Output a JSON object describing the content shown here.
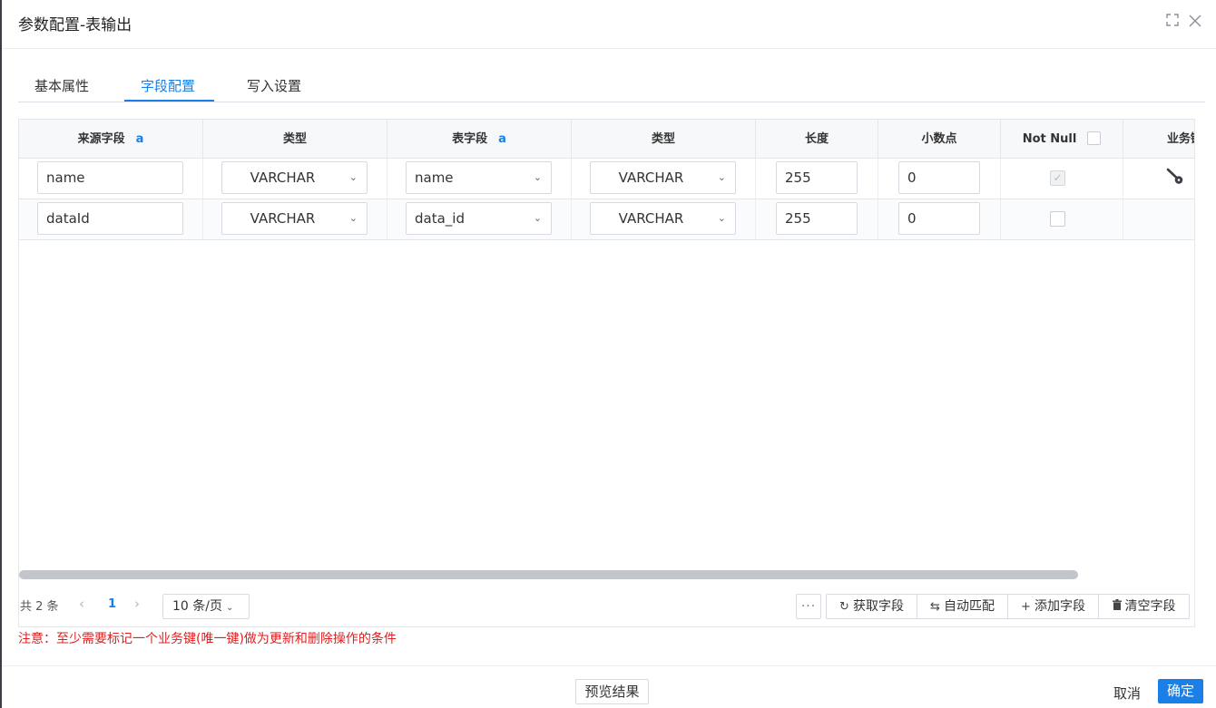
{
  "dialog": {
    "title": "参数配置-表输出",
    "maximize_icon": "expand-icon",
    "close_icon": "close-icon"
  },
  "tabs": [
    {
      "label": "基本属性",
      "active": false
    },
    {
      "label": "字段配置",
      "active": true
    },
    {
      "label": "写入设置",
      "active": false
    }
  ],
  "accent_color": "#1a7fe6",
  "table": {
    "columns": [
      {
        "label": "来源字段",
        "suffix": "a"
      },
      {
        "label": "类型"
      },
      {
        "label": "表字段",
        "suffix": "a"
      },
      {
        "label": "类型"
      },
      {
        "label": "长度"
      },
      {
        "label": "小数点"
      },
      {
        "label": "Not Null"
      },
      {
        "label": "业务键"
      }
    ],
    "rows": [
      {
        "source_field": "name",
        "source_type": "VARCHAR",
        "table_field": "name",
        "table_type": "VARCHAR",
        "length": "255",
        "decimal": "0",
        "not_null": true,
        "not_null_disabled": true,
        "business_key": true
      },
      {
        "source_field": "dataId",
        "source_type": "VARCHAR",
        "table_field": "data_id",
        "table_type": "VARCHAR",
        "length": "255",
        "decimal": "0",
        "not_null": false,
        "not_null_disabled": false,
        "business_key": false
      }
    ]
  },
  "pagination": {
    "total": "共 2 条",
    "current_page": "1",
    "page_size": "10 条/页"
  },
  "actions": {
    "more": "···",
    "fetch_fields": "获取字段",
    "auto_match": "自动匹配",
    "add_field": "添加字段",
    "clear_fields": "清空字段"
  },
  "notice": "注意：至少需要标记一个业务键(唯一键)做为更新和删除操作的条件",
  "notice_color": "#e02020",
  "footer": {
    "preview": "预览结果",
    "cancel": "取消",
    "confirm": "确定"
  }
}
